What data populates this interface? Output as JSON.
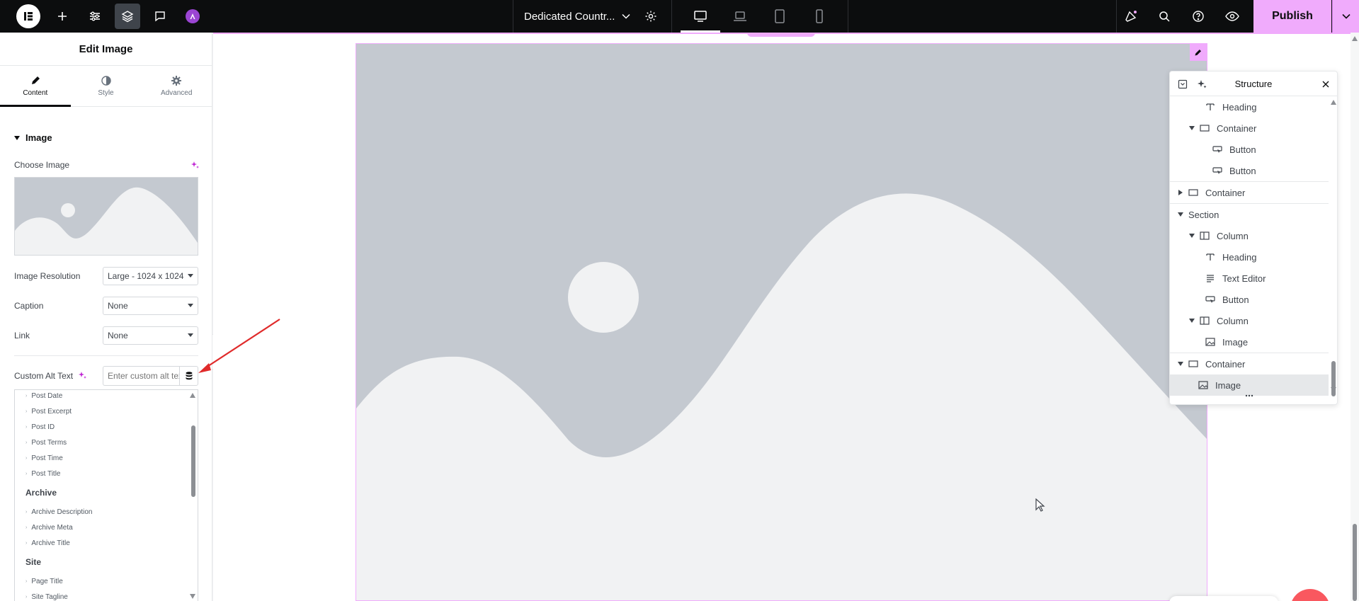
{
  "topbar": {
    "document_title": "Dedicated Countr...",
    "publish_label": "Publish",
    "icons": [
      "elementor-logo-icon",
      "add-icon",
      "settings-sliders-icon",
      "structure-layers-icon",
      "comments-icon",
      "angie-ai-icon",
      "chevron-down-icon",
      "site-settings-gear-icon",
      "desktop-icon",
      "laptop-icon",
      "tablet-icon",
      "mobile-icon",
      "whats-new-icon",
      "search-icon",
      "help-icon",
      "preview-eye-icon",
      "publish-caret-icon"
    ],
    "active_device": "desktop"
  },
  "panel": {
    "title": "Edit Image",
    "tabs": [
      {
        "label": "Content",
        "active": true
      },
      {
        "label": "Style",
        "active": false
      },
      {
        "label": "Advanced",
        "active": false
      }
    ],
    "section_title": "Image",
    "choose_image_label": "Choose Image",
    "image_resolution_label": "Image Resolution",
    "image_resolution_value": "Large - 1024 x 1024",
    "caption_label": "Caption",
    "caption_value": "None",
    "link_label": "Link",
    "link_value": "None",
    "custom_alt_label": "Custom Alt Text",
    "custom_alt_placeholder": "Enter custom alt text"
  },
  "dynamic_tags": {
    "items_top": [
      "Post Date",
      "Post Excerpt",
      "Post ID",
      "Post Terms",
      "Post Time",
      "Post Title"
    ],
    "archive_group": "Archive",
    "archive_items": [
      "Archive Description",
      "Archive Meta",
      "Archive Title"
    ],
    "site_group": "Site",
    "site_items": [
      "Page Title",
      "Site Tagline"
    ]
  },
  "structure": {
    "title": "Structure",
    "rows": [
      {
        "label": "Heading",
        "icon": "heading-icon",
        "toggle": ""
      },
      {
        "label": "Container",
        "icon": "container-icon",
        "toggle": "down"
      },
      {
        "label": "Button",
        "icon": "button-icon",
        "toggle": ""
      },
      {
        "label": "Button",
        "icon": "button-icon",
        "toggle": ""
      },
      {
        "label": "Container",
        "icon": "container-icon",
        "toggle": "right"
      },
      {
        "label": "Section",
        "icon": "",
        "toggle": "down"
      },
      {
        "label": "Column",
        "icon": "column-icon",
        "toggle": "down"
      },
      {
        "label": "Heading",
        "icon": "heading-icon",
        "toggle": ""
      },
      {
        "label": "Text Editor",
        "icon": "text-editor-icon",
        "toggle": ""
      },
      {
        "label": "Button",
        "icon": "button-icon",
        "toggle": ""
      },
      {
        "label": "Column",
        "icon": "column-icon",
        "toggle": "down"
      },
      {
        "label": "Image",
        "icon": "image-icon",
        "toggle": ""
      },
      {
        "label": "Container",
        "icon": "container-icon",
        "toggle": "down"
      },
      {
        "label": "Image",
        "icon": "image-icon",
        "toggle": "",
        "selected": true
      }
    ]
  },
  "colors": {
    "accent_pink": "#f0abfc",
    "topbar_bg": "#0c0d0e",
    "placeholder_gray": "#c4c9d0",
    "arrow_red": "#e02b2b"
  }
}
